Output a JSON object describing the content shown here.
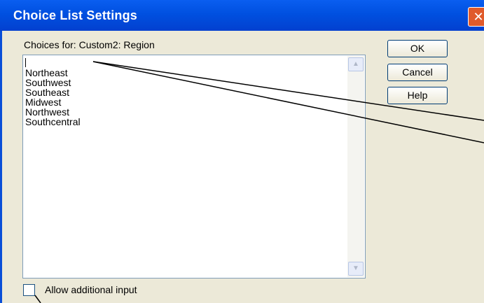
{
  "window": {
    "title": "Choice List Settings",
    "close_glyph": "✕"
  },
  "dialog": {
    "choices_label": "Choices for:  Custom2: Region",
    "items": [
      "Northeast",
      "Southwest",
      "Southeast",
      "Midwest",
      "Northwest",
      "Southcentral"
    ],
    "allow_additional_input_label": "Allow additional input",
    "allow_additional_input_checked": false
  },
  "buttons": {
    "ok": "OK",
    "cancel": "Cancel",
    "help": "Help"
  },
  "scrollbar": {
    "up_glyph": "▲",
    "down_glyph": "▼"
  }
}
